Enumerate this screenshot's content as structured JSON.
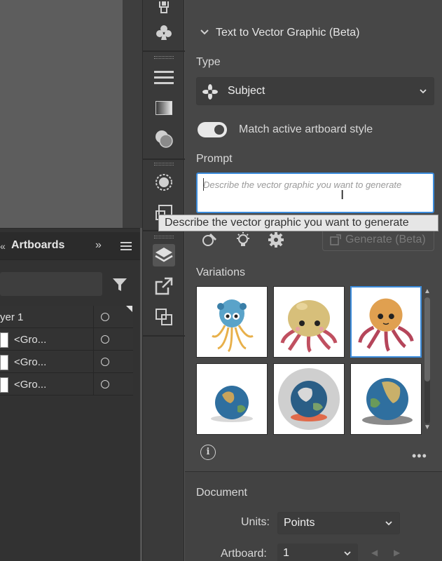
{
  "text_to_vector": {
    "section_title": "Text to Vector Graphic (Beta)",
    "type_label": "Type",
    "type_value": "Subject",
    "match_style_label": "Match active artboard style",
    "match_style_on": true,
    "prompt_label": "Prompt",
    "prompt_placeholder": "Describe the vector graphic you want to generate",
    "tooltip": "Describe the vector graphic you want to generate",
    "generate_label": "Generate (Beta)",
    "variations_label": "Variations",
    "variations": [
      {
        "subject": "blue octopus"
      },
      {
        "subject": "tan octopus"
      },
      {
        "subject": "red octopus",
        "selected": true
      },
      {
        "subject": "earth globe"
      },
      {
        "subject": "earth globe circle"
      },
      {
        "subject": "earth globe shadow"
      }
    ]
  },
  "document": {
    "title": "Document",
    "units_label": "Units:",
    "units_value": "Points",
    "artboard_label": "Artboard:",
    "artboard_value": "1"
  },
  "layers_panel": {
    "tab_prev": "«",
    "tab_label": "Artboards",
    "expand": "»",
    "rows": [
      {
        "name": "yer 1"
      },
      {
        "name": "<Gro..."
      },
      {
        "name": "<Gro..."
      },
      {
        "name": "<Gro..."
      }
    ]
  },
  "colors": {
    "accent": "#3b8bdb",
    "panel_bg": "#474747",
    "toolbar_bg": "#3a3a3a"
  }
}
